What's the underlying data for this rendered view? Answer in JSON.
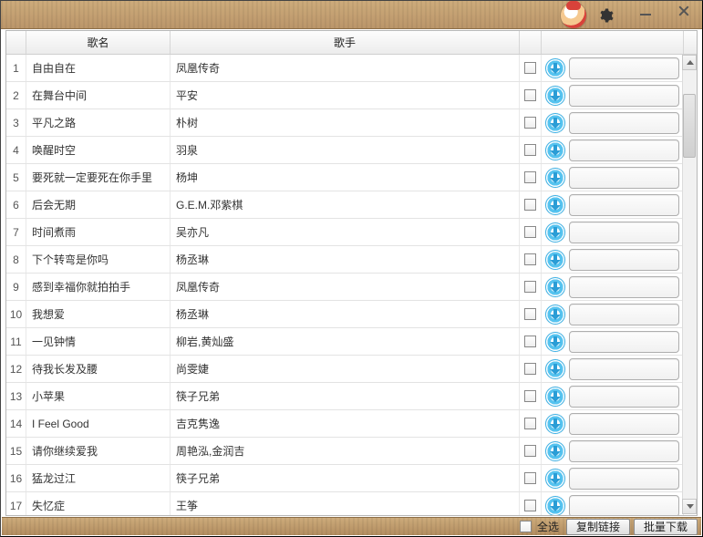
{
  "columns": {
    "song": "歌名",
    "artist": "歌手"
  },
  "rows": [
    {
      "idx": "1",
      "song": "自由自在",
      "artist": "凤凰传奇"
    },
    {
      "idx": "2",
      "song": "在舞台中间",
      "artist": "平安"
    },
    {
      "idx": "3",
      "song": "平凡之路",
      "artist": "朴树"
    },
    {
      "idx": "4",
      "song": "唤醒时空",
      "artist": "羽泉"
    },
    {
      "idx": "5",
      "song": "要死就一定要死在你手里",
      "artist": "杨坤"
    },
    {
      "idx": "6",
      "song": "后会无期",
      "artist": "G.E.M.邓紫棋"
    },
    {
      "idx": "7",
      "song": "时间煮雨",
      "artist": "吴亦凡"
    },
    {
      "idx": "8",
      "song": "下个转弯是你吗",
      "artist": "杨丞琳"
    },
    {
      "idx": "9",
      "song": "感到幸福你就拍拍手",
      "artist": "凤凰传奇"
    },
    {
      "idx": "10",
      "song": "我想爱",
      "artist": "杨丞琳"
    },
    {
      "idx": "11",
      "song": "一见钟情",
      "artist": "柳岩,黄灿盛"
    },
    {
      "idx": "12",
      "song": "待我长发及腰",
      "artist": "尚雯婕"
    },
    {
      "idx": "13",
      "song": "小苹果",
      "artist": "筷子兄弟"
    },
    {
      "idx": "14",
      "song": "I Feel Good",
      "artist": "吉克隽逸"
    },
    {
      "idx": "15",
      "song": "请你继续爱我",
      "artist": "周艳泓,金润吉"
    },
    {
      "idx": "16",
      "song": "猛龙过江",
      "artist": "筷子兄弟"
    },
    {
      "idx": "17",
      "song": "失忆症",
      "artist": "王筝"
    }
  ],
  "footer": {
    "select_all": "全选",
    "copy_links": "复制链接",
    "batch_download": "批量下载"
  }
}
